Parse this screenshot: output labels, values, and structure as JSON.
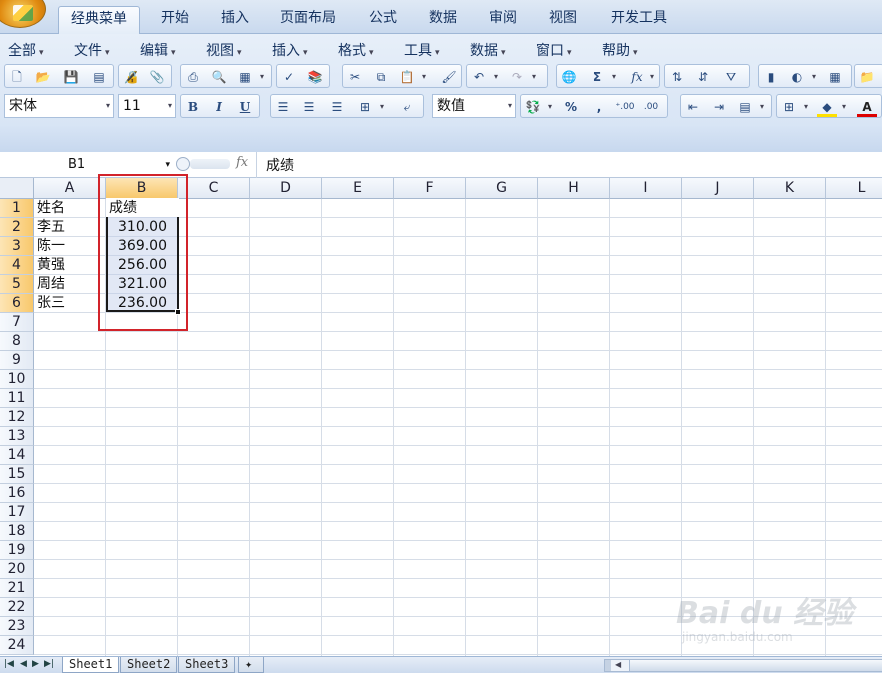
{
  "ribbon_tabs": [
    "经典菜单",
    "开始",
    "插入",
    "页面布局",
    "公式",
    "数据",
    "审阅",
    "视图",
    "开发工具"
  ],
  "active_tab": "经典菜单",
  "menu_items": [
    "全部",
    "文件",
    "编辑",
    "视图",
    "插入",
    "格式",
    "工具",
    "数据",
    "窗口",
    "帮助"
  ],
  "font": {
    "name": "宋体",
    "size": "11"
  },
  "number_format": "数值",
  "toolbar_glyphs": {
    "sum": "Σ",
    "fx": "fx",
    "percent": "%",
    "comma": ",",
    "bold": "B",
    "italic": "I",
    "underline": "U",
    "font_color": "A"
  },
  "name_box": "B1",
  "formula_value": "成绩",
  "columns": [
    "A",
    "B",
    "C",
    "D",
    "E",
    "F",
    "G",
    "H",
    "I",
    "J",
    "K",
    "L"
  ],
  "selected_column": "B",
  "rows": [
    "1",
    "2",
    "3",
    "4",
    "5",
    "6",
    "7",
    "8",
    "9",
    "10",
    "11",
    "12",
    "13",
    "14",
    "15",
    "16",
    "17",
    "18",
    "19",
    "20",
    "21",
    "22",
    "23",
    "24"
  ],
  "selected_rows": [
    "1",
    "2",
    "3",
    "4",
    "5",
    "6"
  ],
  "cells": {
    "A1": "姓名",
    "B1": "成绩",
    "A2": "李五",
    "B2": "310.00",
    "A3": "陈一",
    "B3": "369.00",
    "A4": "黄强",
    "B4": "256.00",
    "A5": "周结",
    "B5": "321.00",
    "A6": "张三",
    "B6": "236.00"
  },
  "sheets": [
    "Sheet1",
    "Sheet2",
    "Sheet3"
  ],
  "active_sheet": "Sheet1",
  "watermark": {
    "text": "Bai du 经验",
    "sub": "jingyan.baidu.com"
  },
  "colors": {
    "selection_border": "#1a1a1a",
    "highlight_box": "#d2232a",
    "header_selected": "#f8c86c"
  }
}
